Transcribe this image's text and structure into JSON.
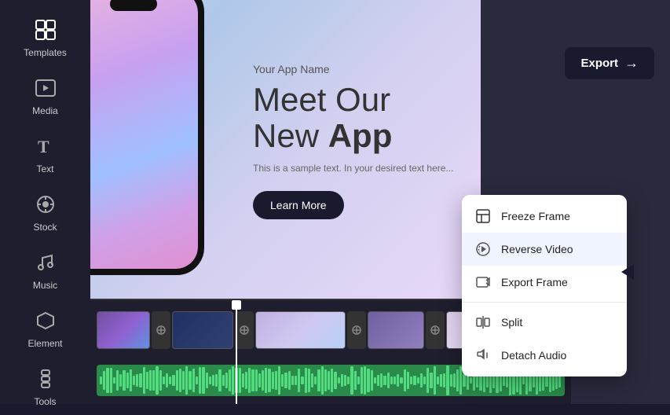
{
  "sidebar": {
    "items": [
      {
        "id": "templates",
        "label": "Templates",
        "active": true
      },
      {
        "id": "media",
        "label": "Media",
        "active": false
      },
      {
        "id": "text",
        "label": "Text",
        "active": false
      },
      {
        "id": "stock",
        "label": "Stock",
        "active": false
      },
      {
        "id": "music",
        "label": "Music",
        "active": false
      },
      {
        "id": "element",
        "label": "Element",
        "active": false
      },
      {
        "id": "tools",
        "label": "Tools",
        "active": false
      }
    ]
  },
  "header": {
    "export_label": "Export",
    "export_arrow": "→"
  },
  "canvas": {
    "app_name": "Your App Name",
    "headline_line1": "Meet Our",
    "headline_line2": "New ",
    "headline_bold": "App",
    "subtext": "This is a sample text. In your desired text here...",
    "cta_label": "Learn More"
  },
  "context_menu": {
    "items": [
      {
        "id": "freeze-frame",
        "label": "Freeze Frame"
      },
      {
        "id": "reverse-video",
        "label": "Reverse Video",
        "highlighted": true
      },
      {
        "id": "export-frame",
        "label": "Export Frame"
      },
      {
        "id": "split",
        "label": "Split"
      },
      {
        "id": "detach-audio",
        "label": "Detach Audio"
      }
    ]
  },
  "timeline": {
    "clips": [
      {
        "type": "clip",
        "width": 70
      },
      {
        "type": "transition"
      },
      {
        "type": "clip",
        "width": 70
      },
      {
        "type": "transition"
      },
      {
        "type": "clip",
        "width": 120
      },
      {
        "type": "transition"
      },
      {
        "type": "clip",
        "width": 80
      },
      {
        "type": "transition"
      },
      {
        "type": "clip",
        "width": 90
      },
      {
        "type": "transition"
      },
      {
        "type": "clip",
        "width": 60
      }
    ]
  }
}
